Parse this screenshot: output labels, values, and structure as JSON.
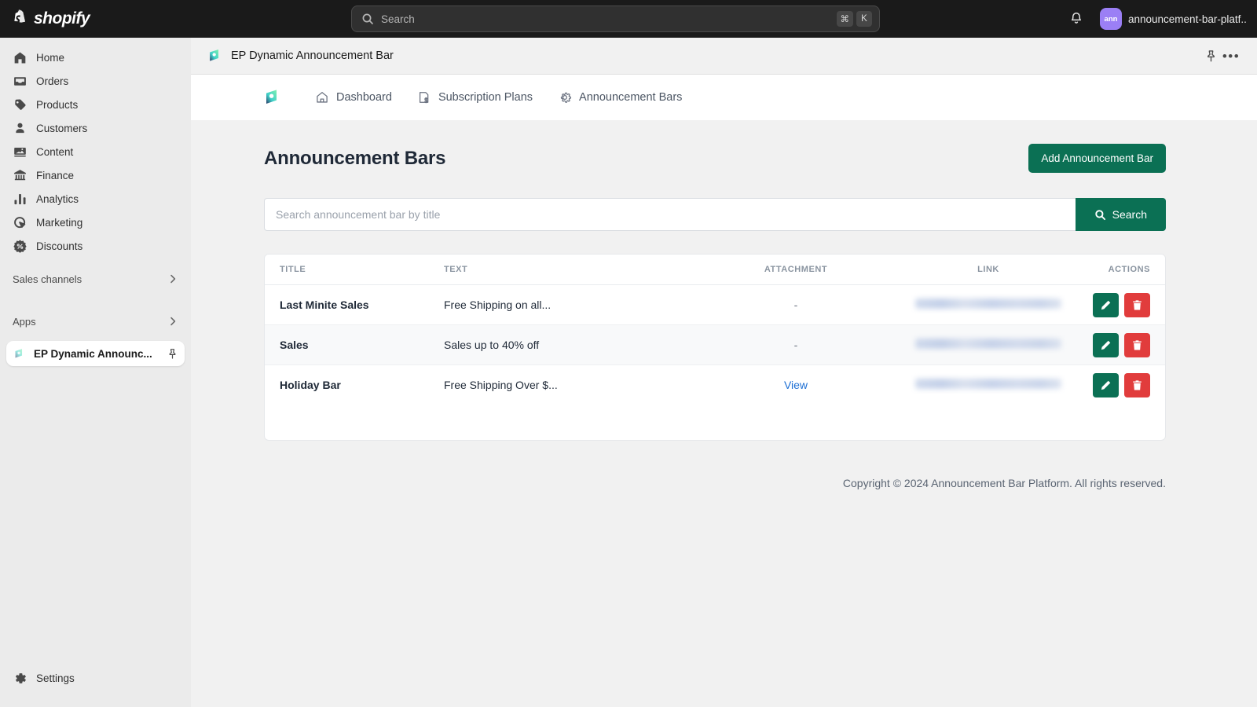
{
  "topbar": {
    "brand": "shopify",
    "brand_icon": "shopify-bag-icon",
    "search": {
      "placeholder": "Search",
      "icon": "search-icon",
      "shortcut_keys": [
        "⌘",
        "K"
      ]
    },
    "notifications_icon": "bell-icon",
    "store": {
      "avatar_initials": "ann",
      "name": "announcement-bar-platf...",
      "avatar_color": "#9b7ff5"
    }
  },
  "sidebar": {
    "items": [
      {
        "label": "Home",
        "icon": "home-icon"
      },
      {
        "label": "Orders",
        "icon": "orders-inbox-icon"
      },
      {
        "label": "Products",
        "icon": "product-tag-icon"
      },
      {
        "label": "Customers",
        "icon": "person-icon"
      },
      {
        "label": "Content",
        "icon": "content-image-icon"
      },
      {
        "label": "Finance",
        "icon": "bank-icon"
      },
      {
        "label": "Analytics",
        "icon": "bar-chart-icon"
      },
      {
        "label": "Marketing",
        "icon": "marketing-target-icon"
      },
      {
        "label": "Discounts",
        "icon": "discount-badge-icon"
      }
    ],
    "sections": [
      {
        "label": "Sales channels",
        "icon": "chevron-right-icon"
      },
      {
        "label": "Apps",
        "icon": "chevron-right-icon"
      }
    ],
    "active_app": {
      "label": "EP Dynamic Announc...",
      "icon": "ep-app-icon",
      "pin_icon": "pin-icon"
    },
    "settings": {
      "label": "Settings",
      "icon": "gear-icon"
    }
  },
  "app_header": {
    "icon": "ep-app-icon",
    "title": "EP Dynamic Announcement Bar",
    "pin_icon": "pin-icon",
    "more_icon": "more-horizontal-icon",
    "more_label": "•••"
  },
  "app_nav": {
    "brand_icon": "ep-app-icon",
    "tabs": [
      {
        "label": "Dashboard",
        "icon": "home-outline-icon"
      },
      {
        "label": "Subscription Plans",
        "icon": "document-dollar-icon"
      },
      {
        "label": "Announcement Bars",
        "icon": "gear-outline-icon"
      }
    ]
  },
  "page": {
    "title": "Announcement Bars",
    "add_button": "Add Announcement Bar",
    "accent_green": "#0b7054",
    "danger_red": "#e13c3c"
  },
  "search_section": {
    "placeholder": "Search announcement bar by title",
    "value": "",
    "button_label": "Search",
    "button_icon": "search-icon"
  },
  "table": {
    "headers": [
      "TITLE",
      "TEXT",
      "ATTACHMENT",
      "LINK",
      "ACTIONS"
    ],
    "rows": [
      {
        "title": "Last Minite Sales",
        "text": "Free Shipping on all...",
        "attachment": "-",
        "attachment_type": "dash",
        "link": "",
        "link_type": "blurred",
        "edit_icon": "pencil-icon",
        "delete_icon": "trash-icon"
      },
      {
        "title": "Sales",
        "text": "Sales up to 40% off",
        "attachment": "-",
        "attachment_type": "dash",
        "link": "",
        "link_type": "blurred",
        "edit_icon": "pencil-icon",
        "delete_icon": "trash-icon"
      },
      {
        "title": "Holiday Bar",
        "text": "Free Shipping Over $...",
        "attachment": "View",
        "attachment_type": "link",
        "link": "",
        "link_type": "blurred",
        "edit_icon": "pencil-icon",
        "delete_icon": "trash-icon"
      }
    ]
  },
  "footer": {
    "copyright": "Copyright © 2024 Announcement Bar Platform. All rights reserved."
  }
}
